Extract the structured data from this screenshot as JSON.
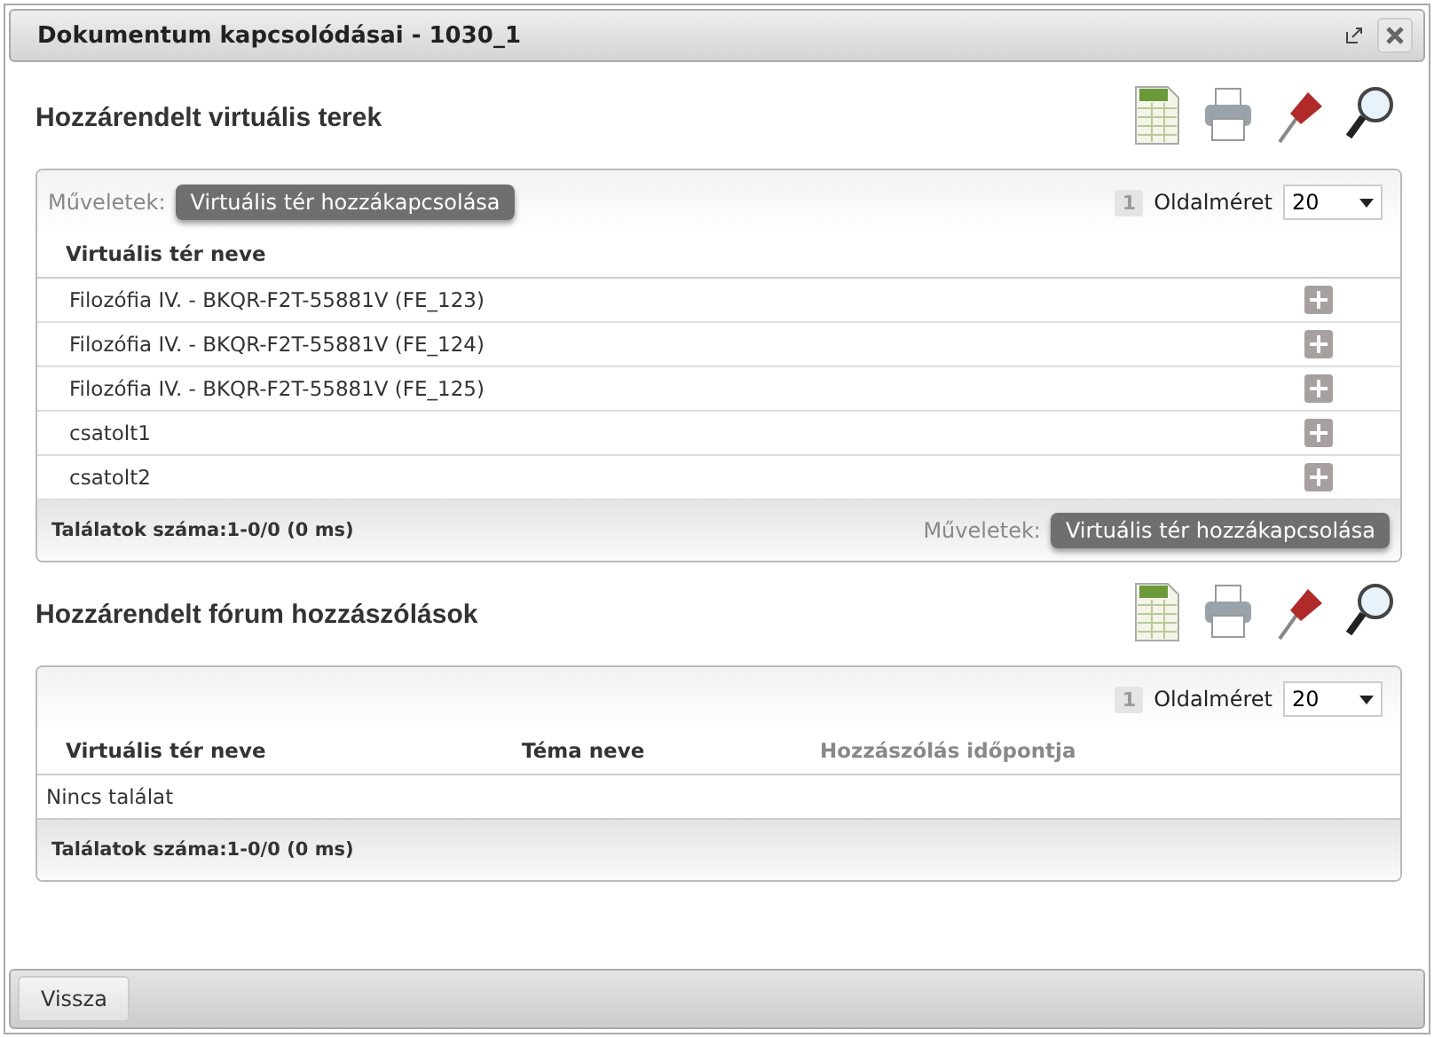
{
  "window": {
    "title": "Dokumentum kapcsolódásai - 1030_1"
  },
  "sections": [
    {
      "title": "Hozzárendelt virtuális terek",
      "toolbar": {
        "label": "Műveletek:",
        "button": "Virtuális tér hozzákapcsolása"
      },
      "page": "1",
      "page_size_label": "Oldalméret",
      "page_size": "20",
      "columns": [
        {
          "label": "Virtuális tér neve",
          "muted": false
        }
      ],
      "rows": [
        {
          "cells": [
            "Filozófia IV. - BKQR-F2T-55881V (FE_123)"
          ]
        },
        {
          "cells": [
            "Filozófia IV. - BKQR-F2T-55881V (FE_124)"
          ]
        },
        {
          "cells": [
            "Filozófia IV. - BKQR-F2T-55881V (FE_125)"
          ]
        },
        {
          "cells": [
            "csatolt1"
          ]
        },
        {
          "cells": [
            "csatolt2"
          ]
        }
      ],
      "footer": {
        "count": "Találatok száma:1-0/0 (0 ms)",
        "label": "Műveletek:",
        "button": "Virtuális tér hozzákapcsolása"
      }
    },
    {
      "title": "Hozzárendelt fórum hozzászólások",
      "page": "1",
      "page_size_label": "Oldalméret",
      "page_size": "20",
      "columns": [
        {
          "label": "Virtuális tér neve",
          "muted": false
        },
        {
          "label": "Téma neve",
          "muted": false
        },
        {
          "label": "Hozzászólás időpontja",
          "muted": true
        }
      ],
      "empty_text": "Nincs találat",
      "footer": {
        "count": "Találatok száma:1-0/0 (0 ms)"
      }
    }
  ],
  "bottom_bar": {
    "button": "Vissza"
  }
}
